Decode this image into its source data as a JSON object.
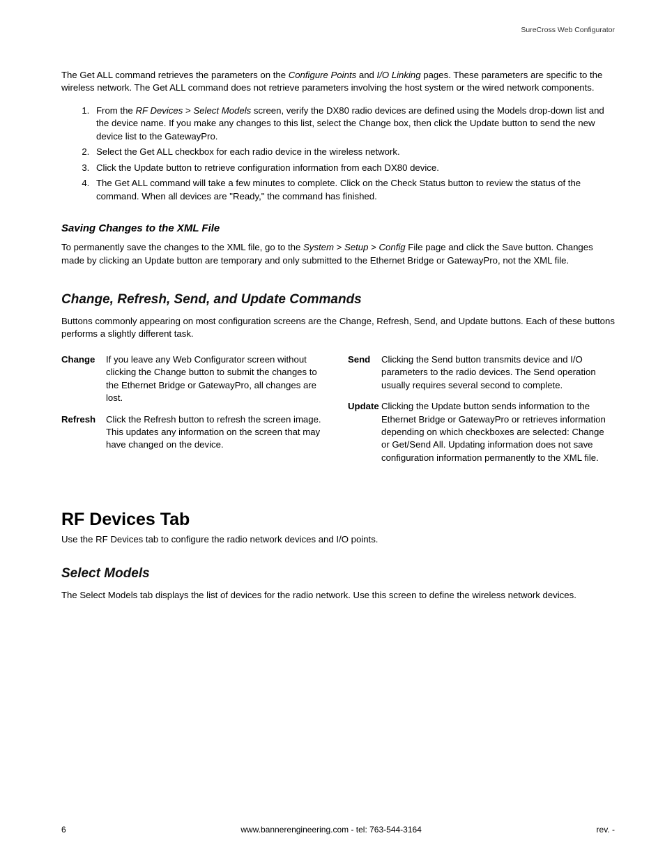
{
  "header": {
    "right": "SureCross Web Configurator"
  },
  "intro": {
    "p1_a": "The Get ALL command retrieves the parameters on the ",
    "p1_i1": "Configure Points",
    "p1_b": " and ",
    "p1_i2": "I/O Linking",
    "p1_c": " pages. These parameters are specific to the wireless network. The Get ALL command does not retrieve parameters involving the host system or the wired network components."
  },
  "steps": {
    "s1_a": "From the ",
    "s1_i1": "RF Devices",
    "s1_b": " > ",
    "s1_i2": "Select Models",
    "s1_c": " screen, verify the DX80 radio devices are defined using the Models drop-down list and the device name. If you make any changes to this list, select the Change box, then click the Update button to send the new device list to the GatewayPro.",
    "s2": "Select the Get ALL checkbox for each radio device in the wireless network.",
    "s3": "Click the Update button to retrieve configuration information from each DX80 device.",
    "s4": "The Get ALL command will take a few minutes to complete. Click on the Check Status button to review the status of the command. When all devices are \"Ready,\" the command has finished."
  },
  "saving": {
    "heading": "Saving Changes to the XML File",
    "p_a": "To permanently save the changes to the XML file, go to the ",
    "p_i1": "System",
    "p_b": " > ",
    "p_i2": "Setup",
    "p_c": " > ",
    "p_i3": "Config",
    "p_d": " File page and click the Save button. Changes made by clicking an Update button are temporary and only submitted to the Ethernet Bridge or GatewayPro, not the XML file."
  },
  "commands": {
    "heading": "Change, Refresh, Send, and Update Commands",
    "intro": "Buttons commonly appearing on most configuration screens are the Change, Refresh, Send, and Update buttons. Each of these buttons performs a slightly different task.",
    "change_term": "Change",
    "change_desc": "If you leave any Web Configurator screen without clicking the Change button to submit the changes to the Ethernet Bridge or GatewayPro, all changes are lost.",
    "refresh_term": "Refresh",
    "refresh_desc": "Click the Refresh button to refresh the screen image. This updates any information on the screen that may have changed on the device.",
    "send_term": "Send",
    "send_desc": "Clicking the Send button transmits device and I/O parameters to the radio devices. The Send operation usually requires several second to complete.",
    "update_term": "Update",
    "update_desc": "Clicking the Update button sends information to the Ethernet Bridge or GatewayPro or retrieves information depending on which checkboxes are selected: Change or Get/Send All. Updating information does not save configuration information permanently to the XML file."
  },
  "rfdevices": {
    "heading": "RF Devices Tab",
    "intro": "Use the RF Devices tab to configure the radio network devices and I/O points."
  },
  "select_models": {
    "heading": "Select Models",
    "intro": "The Select Models tab displays the list of devices for the radio network. Use this screen to define the wireless network devices."
  },
  "footer": {
    "left": "6",
    "center": "www.bannerengineering.com - tel: 763-544-3164",
    "right": "rev. -"
  }
}
